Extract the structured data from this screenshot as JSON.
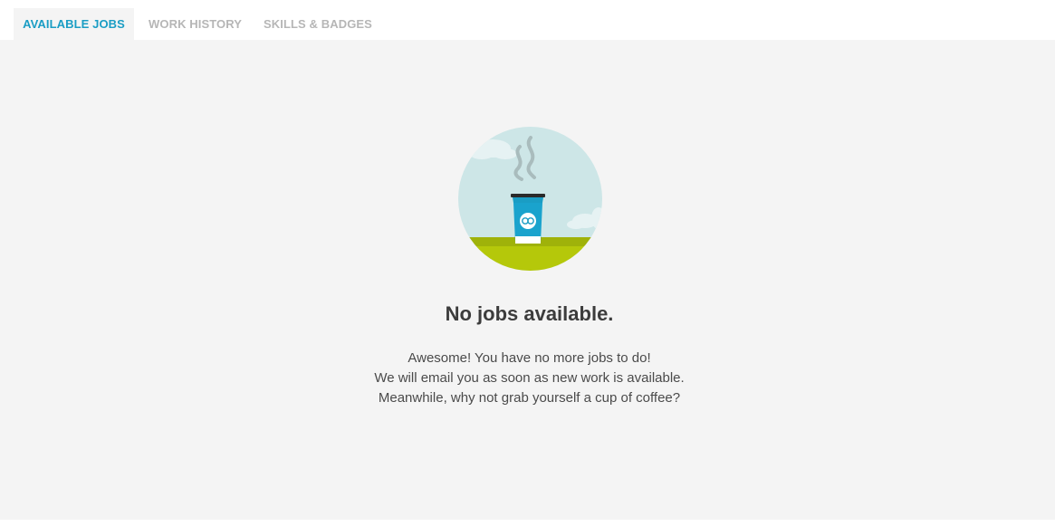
{
  "tabs": [
    {
      "label": "AVAILABLE JOBS",
      "active": true
    },
    {
      "label": "WORK HISTORY",
      "active": false
    },
    {
      "label": "SKILLS & BADGES",
      "active": false
    }
  ],
  "empty_state": {
    "title": "No jobs available.",
    "lines": [
      "Awesome! You have no more jobs to do!",
      "We will email you as soon as new work is available.",
      "Meanwhile, why not grab yourself a cup of coffee?"
    ],
    "illustration": "coffee-cup-illustration"
  },
  "colors": {
    "accent": "#1a9dc4",
    "inactive_tab": "#b6b6b6",
    "background": "#f4f4f4",
    "sky": "#cde6e7",
    "grass": "#b5c80a",
    "cup": "#1a9dc4"
  }
}
